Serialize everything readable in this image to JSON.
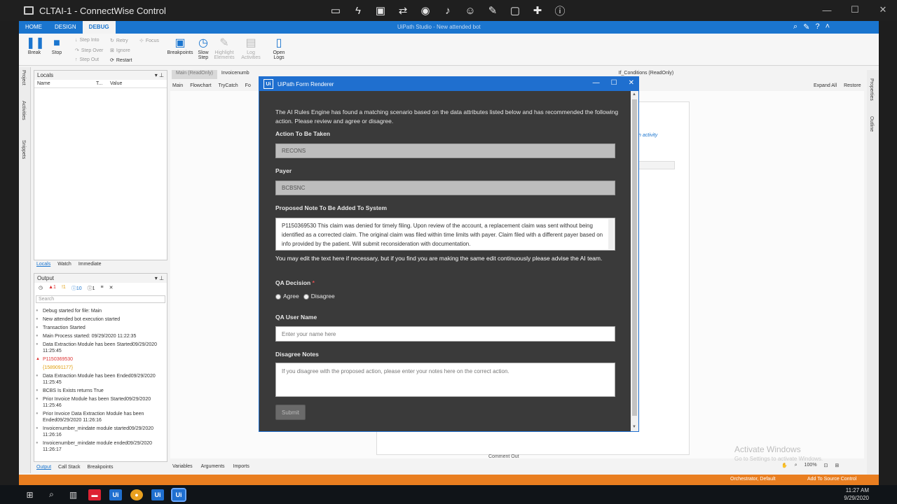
{
  "window": {
    "title": "CLTAI-1 - ConnectWise Control"
  },
  "studio": {
    "title": "UiPath Studio - New attended bot",
    "tabs": [
      "HOME",
      "DESIGN",
      "DEBUG"
    ],
    "ribbon": {
      "break": "Break",
      "stop": "Stop",
      "step_into": "Step Into",
      "step_over": "Step Over",
      "step_out": "Step Out",
      "retry": "Retry",
      "ignore": "Ignore",
      "restart": "Restart",
      "focus": "Focus",
      "breakpoints": "Breakpoints",
      "slow_step_1": "Slow",
      "slow_step_2": "Step",
      "highlight_1": "Highlight",
      "highlight_2": "Elements",
      "log_1": "Log",
      "log_2": "Activities",
      "open_logs_1": "Open",
      "open_logs_2": "Logs"
    },
    "side_labels": [
      "Project",
      "Activities",
      "Snippets"
    ],
    "locals": {
      "title": "Locals",
      "col_name": "Name",
      "col_type": "T...",
      "col_value": "Value"
    },
    "locals_tabs": [
      "Locals",
      "Watch",
      "Immediate"
    ],
    "output": {
      "title": "Output",
      "badges": [
        "1",
        "1",
        "10",
        "1"
      ],
      "search_placeholder": "Search",
      "items": [
        {
          "text": "Debug started for file: Main",
          "kind": "info"
        },
        {
          "text": "New attended bot execution started",
          "kind": "info"
        },
        {
          "text": "Transaction Started",
          "kind": "info"
        },
        {
          "text": "Main Process started: 09/29/2020 11:22:35",
          "kind": "info"
        },
        {
          "text": "Data Extraction Module has been Started09/29/2020 11:25:45",
          "kind": "info"
        },
        {
          "text": "P1150369530",
          "kind": "err"
        },
        {
          "text": "{1589091177}",
          "kind": "warn"
        },
        {
          "text": "Data Extraction Module has been Ended09/29/2020 11:25:45",
          "kind": "info"
        },
        {
          "text": "BCBS Is Exists returns True",
          "kind": "info"
        },
        {
          "text": "Prior Invoice Module has been Started09/29/2020 11:25:46",
          "kind": "info"
        },
        {
          "text": "Prior Invoice Data Extraction Module has been Ended09/29/2020 11:26:16",
          "kind": "info"
        },
        {
          "text": "Invoicenumber_mindate module started09/29/2020 11:26:16",
          "kind": "info"
        },
        {
          "text": "Invoicenumber_mindate module ended09/29/2020 11:26:17",
          "kind": "info"
        }
      ]
    },
    "output_tabs": [
      "Output",
      "Call Stack",
      "Breakpoints"
    ],
    "doc_tabs": [
      "Main (ReadOnly)",
      "Invoicenumb",
      "If_Conditions (ReadOnly)"
    ],
    "breadcrumb": [
      "Main",
      "Flowchart",
      "TryCatch",
      "Fo"
    ],
    "expand_all": "Expand All",
    "restore": "Restore",
    "canvas_hint": "n activity",
    "comment_out": "Comment Out",
    "bottom_tabs": [
      "Variables",
      "Arguments",
      "Imports"
    ],
    "watermark_title": "Activate Windows",
    "watermark_sub": "Go to Settings to activate Windows.",
    "zoom": "100%",
    "status_orchestrator": "Orchestrator, Default",
    "status_source": "Add To Source Control",
    "right_labels": [
      "Properties",
      "Outline"
    ]
  },
  "dialog": {
    "title": "UiPath Form Renderer",
    "intro": "The AI Rules Engine has found a matching scenario based on the data attributes listed below and has recommended the following action. Please review and agree or disagree.",
    "action_label": "Action To Be Taken",
    "action_value": "RECONS",
    "payer_label": "Payer",
    "payer_value": "BCBSNC",
    "note_label": "Proposed Note To Be Added To System",
    "note_value": "P1150369530 This claim was denied for timely filing.  Upon review of the account, a replacement claim was sent without being identified as a corrected claim.  The original claim was filed within time limits with payer.  Claim filed with a different payer based on info provided by the patient.  Will submit reconsideration with documentation.",
    "edit_help": "You may edit the text here if necessary, but if you find you are making the same edit continuously please advise the AI team.",
    "qa_decision_label": "QA Decision",
    "required_mark": "*",
    "agree": "Agree",
    "disagree": "Disagree",
    "qa_user_label": "QA User Name",
    "qa_user_placeholder": "Enter your name here",
    "disagree_notes_label": "Disagree Notes",
    "disagree_notes_placeholder": "If you disagree with the proposed action, please enter your notes here on the correct action.",
    "submit": "Submit"
  },
  "taskbar": {
    "time": "11:27 AM",
    "date": "9/29/2020"
  }
}
